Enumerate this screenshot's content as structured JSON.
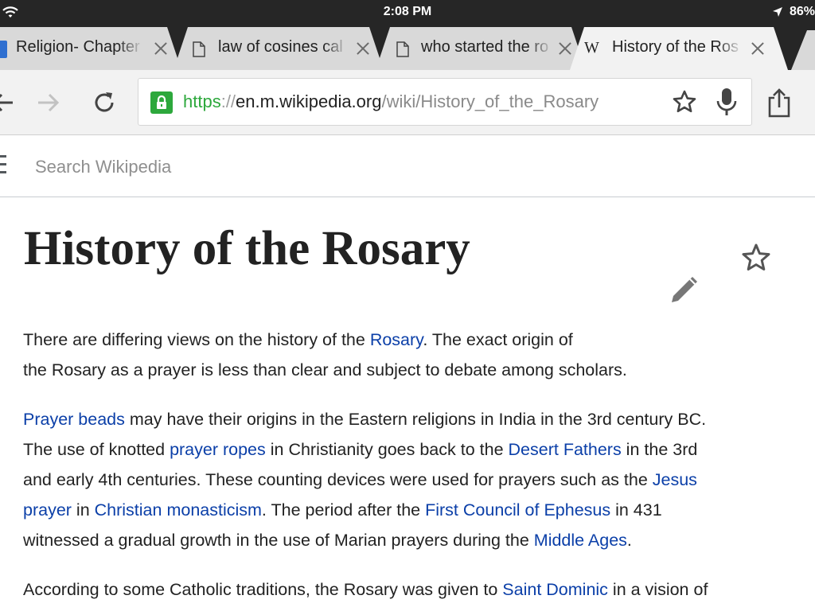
{
  "status_bar": {
    "time": "2:08 PM",
    "battery": "86%"
  },
  "tabs": [
    {
      "title": "Religion- Chapter",
      "favicon": "blue-doc-icon",
      "active": false
    },
    {
      "title": "law of cosines cal",
      "favicon": "page-icon",
      "active": false
    },
    {
      "title": "who started the ro",
      "favicon": "page-icon",
      "active": false
    },
    {
      "title": "History of the Ros",
      "favicon": "wikipedia-w-icon",
      "favicon_text": "W",
      "active": true
    }
  ],
  "address_bar": {
    "scheme": "https",
    "separator": "://",
    "host": "en.m.wikipedia.org",
    "path": "/wiki/History_of_the_Rosary"
  },
  "wiki_search": {
    "placeholder": "Search Wikipedia"
  },
  "article": {
    "title": "History of the Rosary",
    "p1": {
      "line1_a": "There are differing views on the history of the ",
      "line1_link": "Rosary",
      "line1_b": ". The exact origin of",
      "line2": "the Rosary as a prayer is less than clear and subject to debate among scholars."
    },
    "p2": {
      "l1_link": "Prayer beads",
      "l1_text": " may have their origins in the Eastern religions in India in the 3rd century BC.",
      "l2_a": "The use of knotted ",
      "l2_link1": "prayer ropes",
      "l2_b": " in Christianity goes back to the ",
      "l2_link2": "Desert Fathers",
      "l2_c": " in the 3rd",
      "l3_a": "and early 4th centuries. These counting devices were used for prayers such as the ",
      "l3_link": "Jesus",
      "l4_link1": "prayer",
      "l4_a": " in ",
      "l4_link2": "Christian monasticism",
      "l4_b": ". The period after the ",
      "l4_link3": "First Council of Ephesus",
      "l4_c": " in 431",
      "l5_a": "witnessed a gradual growth in the use of Marian prayers during the ",
      "l5_link": "Middle Ages",
      "l5_b": "."
    },
    "p3": {
      "l1_a": "According to some Catholic traditions, the Rosary was given to ",
      "l1_link": "Saint Dominic",
      "l1_b": " in a vision of"
    }
  },
  "colors": {
    "link": "#0b3fa8",
    "secure_green": "#2da83c",
    "status_bar_bg": "#262626",
    "toolbar_bg": "#f2f2f2"
  }
}
